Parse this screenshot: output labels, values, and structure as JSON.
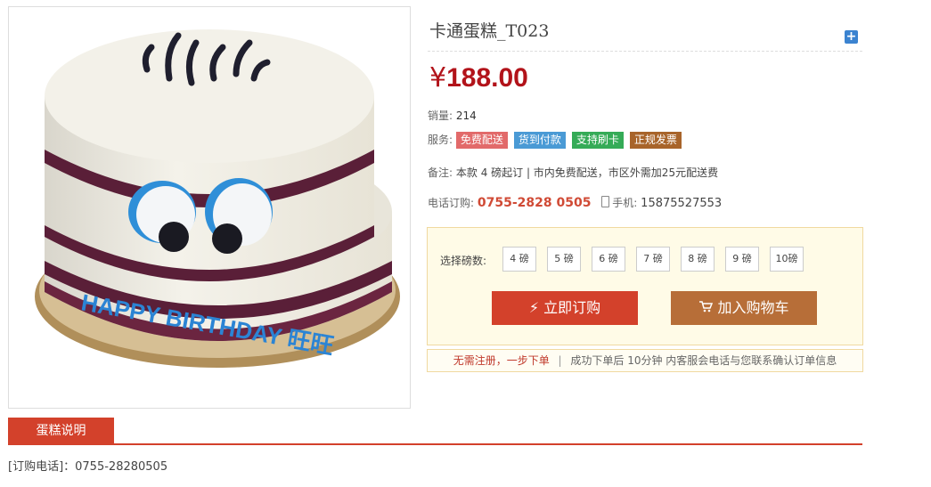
{
  "product": {
    "title": "卡通蛋糕_T023",
    "currency": "¥",
    "price": "188.00",
    "sales_label": "销量:",
    "sales_value": "214",
    "service_label": "服务:",
    "services": [
      "免费配送",
      "货到付款",
      "支持刷卡",
      "正规发票"
    ],
    "remark_label": "备注:",
    "remark": "本款 4 磅起订 | 市内免费配送，市区外需加25元配送费",
    "phone_label": "电话订购:",
    "phone": "0755-2828 0505",
    "mobile_label": "手机:",
    "mobile": "15875527553"
  },
  "image": {
    "cake_text": "HAPPY BIRTHDAY 旺旺"
  },
  "purchase": {
    "weight_label": "选择磅数:",
    "weights": [
      "4 磅",
      "5 磅",
      "6 磅",
      "7 磅",
      "8 磅",
      "9 磅",
      "10磅"
    ],
    "buy_label": "立即订购",
    "cart_label": "加入购物车",
    "note_highlight": "无需注册，一步下单",
    "note_rest": "成功下单后 10分钟 内客服会电话与您联系确认订单信息"
  },
  "tabs": {
    "description": "蛋糕说明"
  },
  "contact": {
    "text": "[订购电话]：0755-28280505"
  },
  "colors": {
    "accent_red": "#d3412b",
    "price_red": "#b2131a",
    "cart_brown": "#b76e38"
  }
}
